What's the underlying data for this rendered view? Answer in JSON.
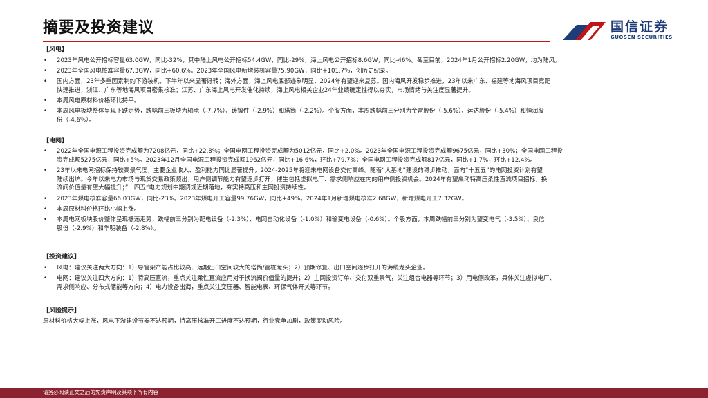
{
  "page": {
    "title": "摘要及投资建议"
  },
  "logo": {
    "name_cn": "国信证券",
    "name_en": "GUOSEN SECURITIES",
    "color_primary": "#1e3c78",
    "color_accent": "#c2151b"
  },
  "sections": {
    "wind": {
      "heading": "【风电】",
      "bullets": [
        [
          "2023年风电公开招标容量63.0GW，同比-32%，其中陆上风电公开招标54.4GW，同比-29%，海上风电公开招标8.6GW，同比-46%。截至目前，2024年1月公开招标2.20GW，均为陆风。"
        ],
        [
          "2023年全国风电核准容量67.3GW，同比+60.6%。2023年全国风电新增装机容量75.90GW，同比+101.7%，创历史纪录。"
        ],
        [
          "国内方面，23年多重因素制约下游装机，下半年以来显著好转；海外方面，海上风电底部迹象明显，2024年有望迎来复苏。国内海风开发稳步推进，23年以来广东、福建等地海风项目竞配",
          "快速推进，浙江、广东等地海风项目密集核准；江苏、广东海上风电开发催化持续，海上风电相关企业24年业绩确定性得以夯实，市场情绪与关注度显著提升。"
        ],
        [
          "本周风电原材料价格环比持平。"
        ],
        [
          "本周风电板块整体呈现下跌走势，跌幅前三板块为轴承（-7.7%）、铸锻件（-2.9%）和塔筒（-2.2%）。个股方面，本周跌幅前三分别为金雷股份（-5.6%）、运达股份（-5.4%）和恒润股",
          "份（-4.6%）。"
        ]
      ]
    },
    "grid": {
      "heading": "【电网】",
      "bullets": [
        [
          "2022年全国电源工程投资完成额为7208亿元，同比+22.8%；全国电网工程投资完成额为5012亿元，同比+2.0%。2023年全国电源工程投资完成额9675亿元，同比+30%；全国电网工程投",
          "资完成额5275亿元，同比+5%。2023年12月全国电源工程投资完成额1962亿元，同比+16.6%，环比+79.7%；全国电网工程投资完成额817亿元，同比+1.7%，环比+12.4%。"
        ],
        [
          "23年以来电网招标保持较高景气度，主要企业收入、盈利能力同比显著提升，2024-2025年将迎来电网设备交付高峰。随着“大基地”建设的稳步推动，面向“十五五”的电网投资计划有望",
          "陆续出炉。今年以来电力市场与现货交易政策频出，用户侧调节能力有望逐步打开，催生包括虚拟电厂、需求侧响应在内的用户侧投资机会。2024年有望启动特高压柔性直流项目招标，换",
          "流阀价值量有望大幅提升；”十四五“电力规划中期调规近期落地，夯实特高压和主网投资持续性。"
        ],
        [
          "2023年煤电核准容量66.03GW，同比-23%。2023年煤电开工容量99.76GW，同比+49%。2024年1月新增煤电核准2.68GW，新增煤电开工7.32GW。"
        ],
        [
          "本周原材料价格环比小幅上涨。"
        ],
        [
          "本周电网板块股价整体呈现振荡走势，跌幅前三分别为配电设备（-2.3%）、电网自动化设备（-1.0%）和输变电设备（-0.6%）。个股方面，本周跌幅前三分别为望变电气（-3.5%）、良信",
          "股份（-2.9%）和华明装备（-2.8%）。"
        ]
      ]
    },
    "investment": {
      "heading": "【投资建议】",
      "bullets": [
        [
          "风电：建议关注两大方向：1）导管架产能占比较高、远期出口空间较大的塔筒/管桩龙头；2）预期修复、出口空间逐步打开的海缆龙头企业。"
        ],
        [
          "电网：建议关注四大方向：1）特高压直流，重点关注柔性直流应用对于换流阀价值量的提升；2）主网投资订单、交付双重景气，关注组合电器等环节；3）用电侧改革，具体关注虚拟电厂、",
          "需求侧响应、分布式储能等方向；4）电力设备出海，重点关注变压器、智能电表、环保气体开关等环节。"
        ]
      ]
    },
    "risk": {
      "heading": "【风险提示】",
      "text": "原材料价格大幅上涨，风电下游建设节奏不达预期，特高压核准开工进度不达预期，行业竞争加剧，政策变动风险。"
    }
  },
  "footer": {
    "text": "请务必阅读正文之后的免责声明及其项下所有内容",
    "bg_color": "#8b2230"
  }
}
